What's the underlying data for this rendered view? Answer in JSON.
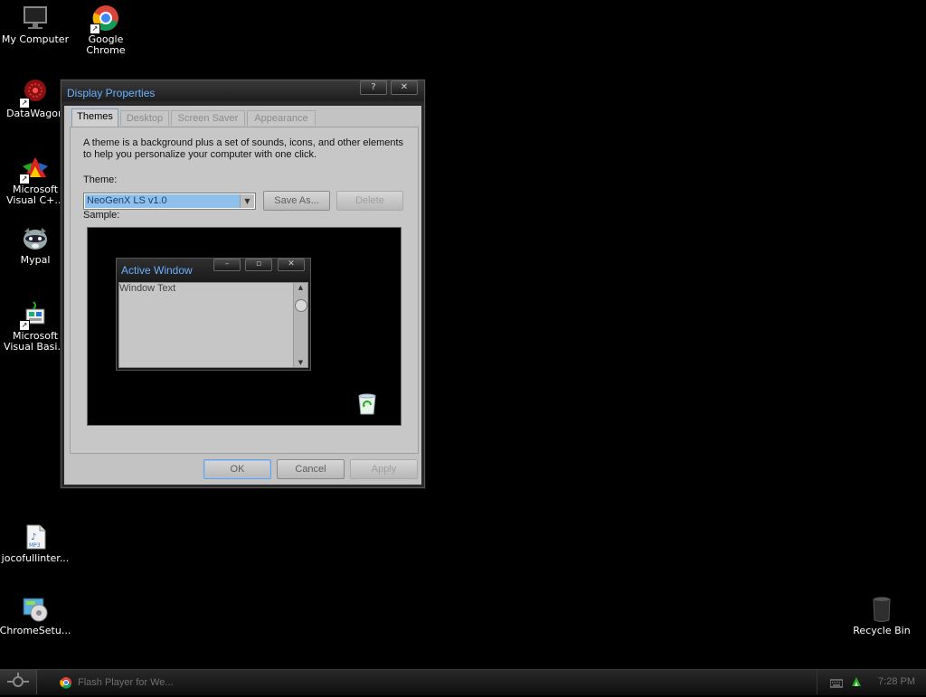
{
  "desktop": {
    "icons": [
      {
        "label": "My Computer",
        "icon": "monitor-icon"
      },
      {
        "label": "Google\nChrome",
        "icon": "chrome-icon"
      },
      {
        "label": "DataWagon",
        "icon": "datawagon-icon"
      },
      {
        "label": "Microsoft\nVisual C+...",
        "icon": "visual-cpp-icon"
      },
      {
        "label": "Mypal",
        "icon": "raccoon-icon"
      },
      {
        "label": "Microsoft\nVisual Basi...",
        "icon": "visual-basic-icon"
      },
      {
        "label": "jocofullinter...",
        "icon": "mp3-file-icon"
      },
      {
        "label": "ChromeSetu...",
        "icon": "installer-icon"
      },
      {
        "label": "Recycle Bin",
        "icon": "recycle-bin-icon"
      }
    ]
  },
  "dialog": {
    "title": "Display Properties",
    "title_buttons": {
      "help": "?",
      "close": "✕"
    },
    "tabs": [
      {
        "label": "Themes",
        "active": true
      },
      {
        "label": "Desktop",
        "active": false
      },
      {
        "label": "Screen Saver",
        "active": false
      },
      {
        "label": "Appearance",
        "active": false
      }
    ],
    "description": "A theme is a background plus a set of sounds, icons, and other elements to help you personalize your computer with one click.",
    "theme_label": "Theme:",
    "theme_value": "NeoGenX LS v1.0",
    "save_as_label": "Save As...",
    "delete_label": "Delete",
    "sample_label": "Sample:",
    "sample_window": {
      "title": "Active Window",
      "text": "Window Text",
      "buttons": {
        "minimize": "–",
        "maximize": "▫",
        "close": "✕"
      }
    },
    "ok_label": "OK",
    "cancel_label": "Cancel",
    "apply_label": "Apply"
  },
  "taskbar": {
    "task_label": "Flash Player for We...",
    "clock": "7:28 PM"
  },
  "colors": {
    "accent_title": "#6ab0ff",
    "selection": "#8fc0ec",
    "dialog_face": "#c3c3c3",
    "desktop_bg": "#000000"
  }
}
